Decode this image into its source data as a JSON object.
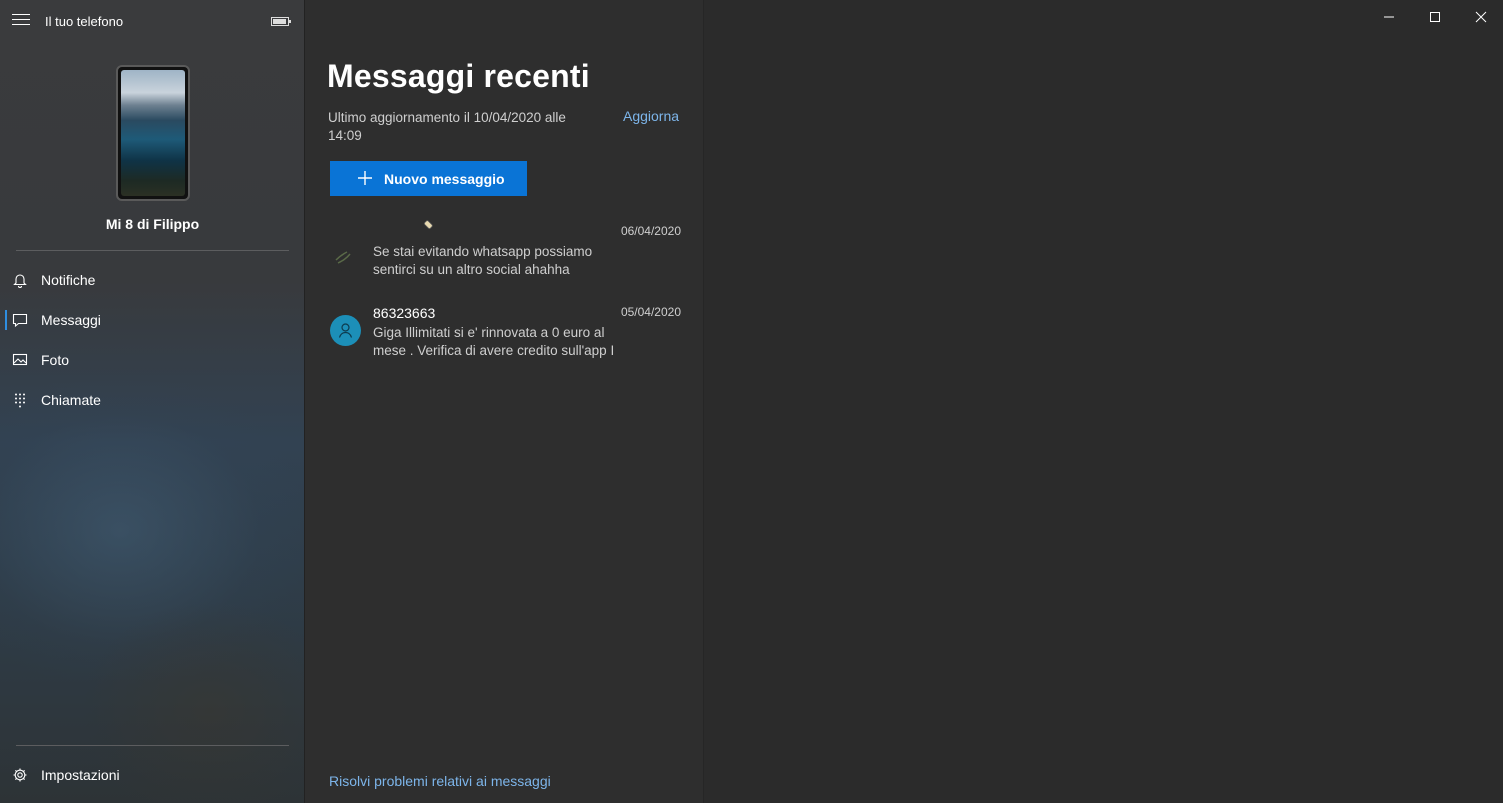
{
  "app": {
    "title": "Il tuo telefono"
  },
  "device": {
    "name": "Mi 8 di Filippo"
  },
  "nav": {
    "items": [
      {
        "label": "Notifiche",
        "icon": "bell-icon"
      },
      {
        "label": "Messaggi",
        "icon": "chat-icon",
        "active": true
      },
      {
        "label": "Foto",
        "icon": "photo-icon"
      },
      {
        "label": "Chiamate",
        "icon": "dialpad-icon"
      }
    ],
    "settings_label": "Impostazioni"
  },
  "messages": {
    "title": "Messaggi recenti",
    "last_update": "Ultimo aggiornamento il 10/04/2020 alle 14:09",
    "refresh_label": "Aggiorna",
    "new_message_label": "Nuovo messaggio",
    "conversations": [
      {
        "sender": "",
        "date": "06/04/2020",
        "preview": "Se stai evitando whatsapp possiamo sentirci su un altro social ahahha",
        "avatar": "contact-photo"
      },
      {
        "sender": "86323663",
        "date": "05/04/2020",
        "preview": "Giga Illimitati si e' rinnovata a 0 euro al mese . Verifica di avere credito sull'app I",
        "avatar": "person-icon"
      }
    ],
    "troubleshoot_label": "Risolvi problemi relativi ai messaggi"
  },
  "colors": {
    "accent": "#0a74d6",
    "link": "#7db5ea",
    "avatar": "#1c8fb8"
  }
}
